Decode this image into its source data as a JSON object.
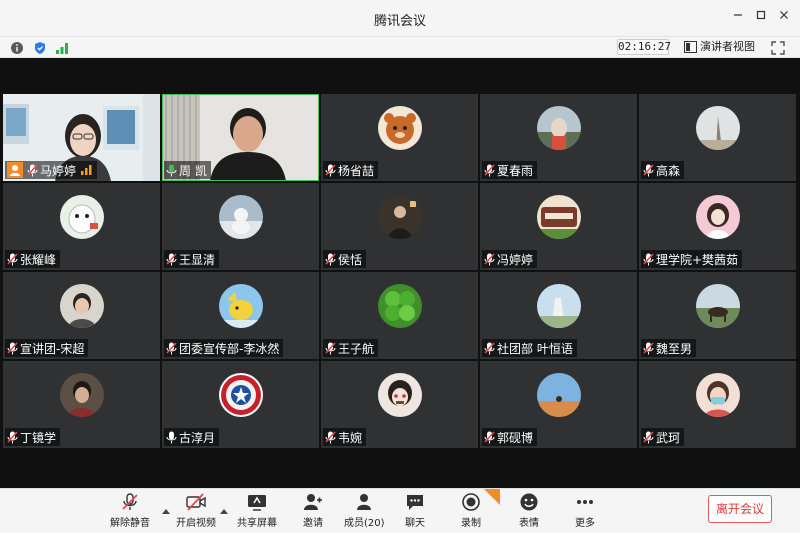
{
  "window": {
    "title": "腾讯会议"
  },
  "infobar": {
    "timer": "02:16:27",
    "speaker_view_label": "演讲者视图"
  },
  "participants": [
    {
      "name": "马婷婷",
      "mic": "muted-icon",
      "kind": "video"
    },
    {
      "name": "周 凯",
      "mic": "talking-icon",
      "kind": "video"
    },
    {
      "name": "杨省喆",
      "mic": "muted-icon",
      "kind": "avatar",
      "color": "#c96a2b"
    },
    {
      "name": "夏春雨",
      "mic": "muted-icon",
      "kind": "avatar",
      "color": "#8aa0b0"
    },
    {
      "name": "高森",
      "mic": "muted-icon",
      "kind": "avatar",
      "color": "#d7c7a6"
    },
    {
      "name": "张耀峰",
      "mic": "muted-icon",
      "kind": "avatar",
      "color": "#e6efe8"
    },
    {
      "name": "王显清",
      "mic": "muted-icon",
      "kind": "avatar",
      "color": "#9bb3c8"
    },
    {
      "name": "侯恬",
      "mic": "muted-icon",
      "kind": "avatar",
      "color": "#6b5a44"
    },
    {
      "name": "冯婷婷",
      "mic": "muted-icon",
      "kind": "avatar",
      "color": "#a24a3c"
    },
    {
      "name": "理学院+樊茜茹",
      "mic": "muted-icon",
      "kind": "avatar",
      "color": "#f0b6c9"
    },
    {
      "name": "宣讲团-宋超",
      "mic": "muted-icon",
      "kind": "avatar",
      "color": "#c9c3b8"
    },
    {
      "name": "团委宣传部-李冰然",
      "mic": "muted-icon",
      "kind": "avatar",
      "color": "#7fb6e0"
    },
    {
      "name": "王子航",
      "mic": "muted-icon",
      "kind": "avatar",
      "color": "#4caf2f"
    },
    {
      "name": "社团部 叶恒语",
      "mic": "muted-icon",
      "kind": "avatar",
      "color": "#b8d3e8"
    },
    {
      "name": "魏至男",
      "mic": "muted-icon",
      "kind": "avatar",
      "color": "#6f8a5a"
    },
    {
      "name": "丁镜学",
      "mic": "muted-icon",
      "kind": "avatar",
      "color": "#5b4f43"
    },
    {
      "name": "古淳月",
      "mic": "talking-icon",
      "kind": "avatar",
      "color": "#1e4fa0"
    },
    {
      "name": "韦婉",
      "mic": "muted-icon",
      "kind": "avatar",
      "color": "#e5d6d0"
    },
    {
      "name": "郭砚博",
      "mic": "muted-icon",
      "kind": "avatar",
      "color": "#d98c4a"
    },
    {
      "name": "武珂",
      "mic": "muted-icon",
      "kind": "avatar",
      "color": "#e9c7b6"
    }
  ],
  "toolbar": {
    "unmute": "解除静音",
    "start_video": "开启视频",
    "share_screen": "共享屏幕",
    "invite": "邀请",
    "members": "成员(20)",
    "chat": "聊天",
    "record": "录制",
    "reactions": "表情",
    "more": "更多",
    "leave": "离开会议"
  },
  "colors": {
    "accent": "#3fbf5a",
    "leave": "#d93a3a",
    "tile_bg": "#2f3133"
  }
}
